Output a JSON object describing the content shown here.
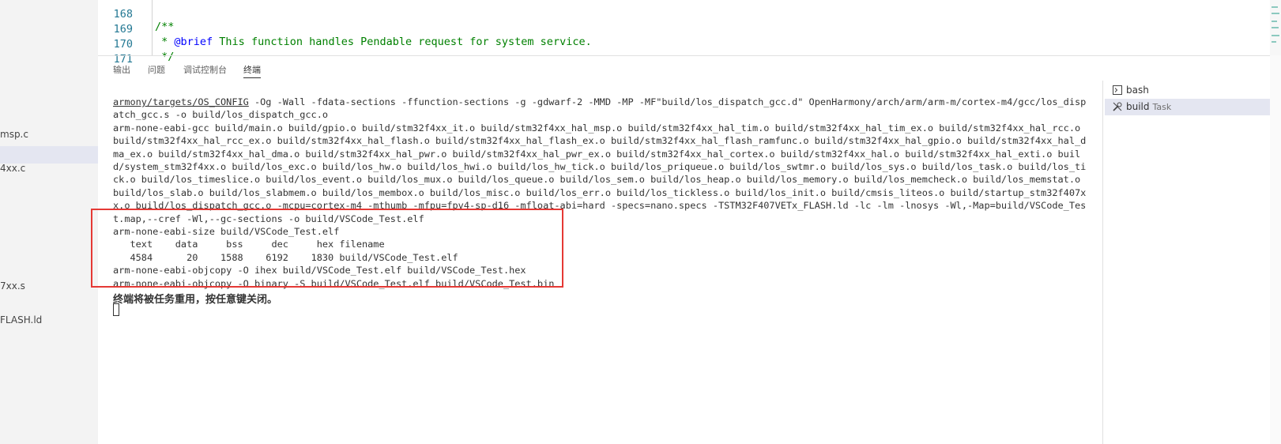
{
  "sidebar": {
    "files": [
      "msp.c",
      "4xx.c",
      "7xx.s",
      "FLASH.ld"
    ]
  },
  "editor": {
    "lines": [
      {
        "num": "168",
        "code": "/**"
      },
      {
        "num": "169",
        "prefix": " * ",
        "tag": "@brief",
        "code": " This function handles Pendable request for system service."
      },
      {
        "num": "170",
        "code": " */"
      },
      {
        "num": "171",
        "code": ""
      }
    ]
  },
  "panel": {
    "tabs": [
      "输出",
      "问题",
      "调试控制台",
      "终端"
    ],
    "active_tab": "终端"
  },
  "terminal": {
    "cmd_path": "armony/targets/OS_CONFIG",
    "line1_rest": " -Og -Wall -fdata-sections -ffunction-sections -g -gdwarf-2 -MMD -MP -MF\"build/los_dispatch_gcc.d\" OpenHarmony/arch/arm/arm-m/cortex-m4/gcc/los_dispatch_gcc.s -o build/los_dispatch_gcc.o",
    "link_cmd": "arm-none-eabi-gcc build/main.o build/gpio.o build/stm32f4xx_it.o build/stm32f4xx_hal_msp.o build/stm32f4xx_hal_tim.o build/stm32f4xx_hal_tim_ex.o build/stm32f4xx_hal_rcc.o build/stm32f4xx_hal_rcc_ex.o build/stm32f4xx_hal_flash.o build/stm32f4xx_hal_flash_ex.o build/stm32f4xx_hal_flash_ramfunc.o build/stm32f4xx_hal_gpio.o build/stm32f4xx_hal_dma_ex.o build/stm32f4xx_hal_dma.o build/stm32f4xx_hal_pwr.o build/stm32f4xx_hal_pwr_ex.o build/stm32f4xx_hal_cortex.o build/stm32f4xx_hal.o build/stm32f4xx_hal_exti.o build/system_stm32f4xx.o build/los_exc.o build/los_hw.o build/los_hwi.o build/los_hw_tick.o build/los_priqueue.o build/los_swtmr.o build/los_sys.o build/los_task.o build/los_tick.o build/los_timeslice.o build/los_event.o build/los_mux.o build/los_queue.o build/los_sem.o build/los_heap.o build/los_memory.o build/los_memcheck.o build/los_memstat.o build/los_slab.o build/los_slabmem.o build/los_membox.o build/los_misc.o build/los_err.o build/los_tickless.o build/los_init.o build/cmsis_liteos.o build/startup_stm32f407xx.o build/los_dispatch_gcc.o -mcpu=cortex-m4 -mthumb -mfpu=fpv4-sp-d16 -mfloat-abi=hard -specs=nano.specs -TSTM32F407VETx_FLASH.ld -lc -lm -lnosys -Wl,-Map=build/VSCode_Test.map,--cref -Wl,--gc-sections -o build/VSCode_Test.elf",
    "size_cmd": "arm-none-eabi-size build/VSCode_Test.elf",
    "size_header": "   text    data     bss     dec     hex filename",
    "size_row": "   4584      20    1588    6192    1830 build/VSCode_Test.elf",
    "objcopy_hex": "arm-none-eabi-objcopy -O ihex build/VSCode_Test.elf build/VSCode_Test.hex",
    "objcopy_bin": "arm-none-eabi-objcopy -O binary -S build/VSCode_Test.elf build/VSCode_Test.bin",
    "notice": "终端将被任务重用，按任意键关闭。"
  },
  "terminal_list": [
    {
      "label": "bash",
      "sub": "",
      "icon": "terminal-icon"
    },
    {
      "label": "build",
      "sub": "Task",
      "icon": "tools-icon"
    }
  ],
  "colors": {
    "highlight_box": "#e53935",
    "comment": "#008000",
    "doc_tag": "#0000ff",
    "line_number": "#237893"
  }
}
